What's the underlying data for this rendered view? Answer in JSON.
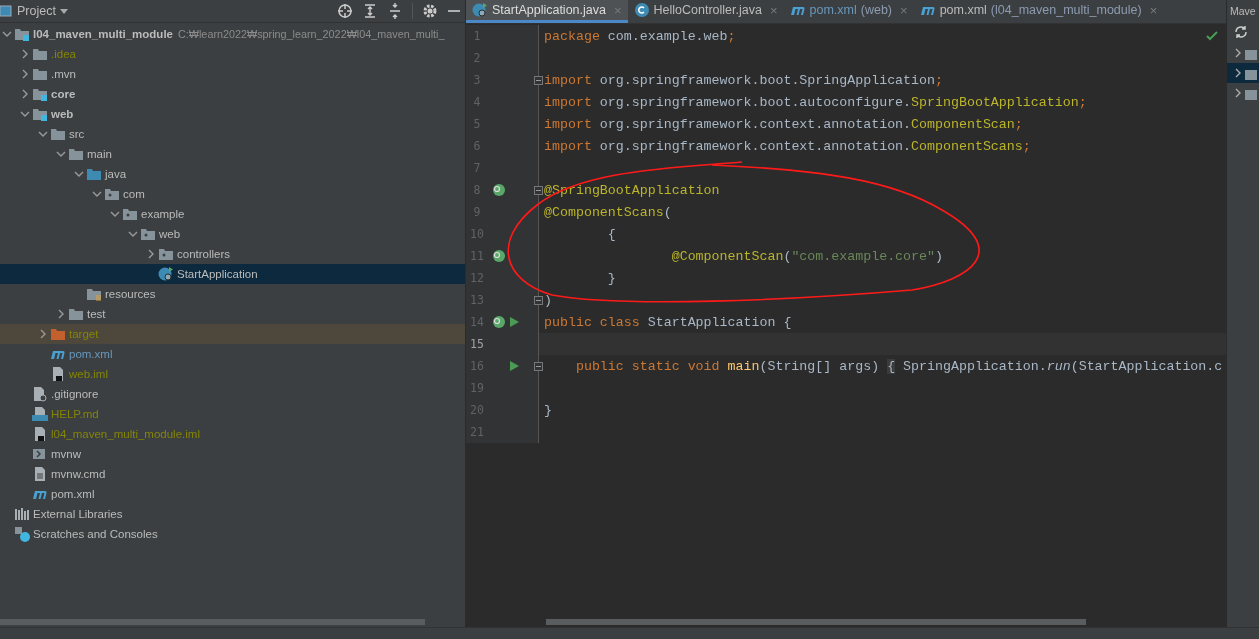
{
  "project_panel": {
    "title": "Project",
    "tree": [
      {
        "label": "l04_maven_multi_module",
        "kind": "module",
        "bold": true,
        "expanded": true,
        "path": "C:₩learn2022₩spring_learn_2022₩l04_maven_multi_",
        "ignored": false,
        "modified": false,
        "selected": false,
        "children": [
          {
            "label": ".idea",
            "kind": "folder",
            "expanded": false,
            "ignored": true,
            "modified": false,
            "selected": false
          },
          {
            "label": ".mvn",
            "kind": "folder",
            "expanded": false,
            "ignored": false,
            "modified": false,
            "selected": false
          },
          {
            "label": "core",
            "kind": "module",
            "bold": true,
            "expanded": false,
            "ignored": false,
            "modified": false,
            "selected": false
          },
          {
            "label": "web",
            "kind": "module",
            "bold": true,
            "expanded": true,
            "ignored": false,
            "modified": false,
            "selected": false,
            "children": [
              {
                "label": "src",
                "kind": "folder",
                "expanded": true,
                "ignored": false,
                "modified": false,
                "selected": false,
                "children": [
                  {
                    "label": "main",
                    "kind": "folder",
                    "expanded": true,
                    "ignored": false,
                    "modified": false,
                    "selected": false,
                    "children": [
                      {
                        "label": "java",
                        "kind": "source",
                        "expanded": true,
                        "ignored": false,
                        "modified": false,
                        "selected": false,
                        "children": [
                          {
                            "label": "com",
                            "kind": "package",
                            "expanded": true,
                            "ignored": false,
                            "modified": false,
                            "selected": false,
                            "children": [
                              {
                                "label": "example",
                                "kind": "package",
                                "expanded": true,
                                "ignored": false,
                                "modified": false,
                                "selected": false,
                                "children": [
                                  {
                                    "label": "web",
                                    "kind": "package",
                                    "expanded": true,
                                    "ignored": false,
                                    "modified": false,
                                    "selected": false,
                                    "children": [
                                      {
                                        "label": "controllers",
                                        "kind": "package",
                                        "expanded": false,
                                        "ignored": false,
                                        "modified": false,
                                        "selected": false
                                      },
                                      {
                                        "label": "StartApplication",
                                        "kind": "spring-class",
                                        "ignored": false,
                                        "modified": false,
                                        "selected": true
                                      }
                                    ]
                                  }
                                ]
                              }
                            ]
                          }
                        ]
                      },
                      {
                        "label": "resources",
                        "kind": "resources",
                        "ignored": false,
                        "modified": false,
                        "selected": false
                      }
                    ]
                  },
                  {
                    "label": "test",
                    "kind": "folder",
                    "expanded": false,
                    "ignored": false,
                    "modified": false,
                    "selected": false
                  }
                ]
              },
              {
                "label": "target",
                "kind": "excluded",
                "expanded": false,
                "ignored": true,
                "modified": false,
                "selected": false
              },
              {
                "label": "pom.xml",
                "kind": "maven",
                "ignored": false,
                "modified": true,
                "selected": false
              },
              {
                "label": "web.iml",
                "kind": "iml",
                "ignored": true,
                "modified": false,
                "selected": false
              }
            ]
          },
          {
            "label": ".gitignore",
            "kind": "gitignore",
            "ignored": false,
            "modified": false,
            "selected": false
          },
          {
            "label": "HELP.md",
            "kind": "markdown",
            "ignored": true,
            "modified": false,
            "selected": false
          },
          {
            "label": "l04_maven_multi_module.iml",
            "kind": "iml",
            "ignored": true,
            "modified": false,
            "selected": false
          },
          {
            "label": "mvnw",
            "kind": "script",
            "ignored": false,
            "modified": false,
            "selected": false
          },
          {
            "label": "mvnw.cmd",
            "kind": "text",
            "ignored": false,
            "modified": false,
            "selected": false
          },
          {
            "label": "pom.xml",
            "kind": "maven",
            "ignored": false,
            "modified": false,
            "selected": false
          }
        ]
      },
      {
        "label": "External Libraries",
        "kind": "libraries",
        "ignored": false,
        "modified": false,
        "selected": false
      },
      {
        "label": "Scratches and Consoles",
        "kind": "scratches",
        "ignored": false,
        "modified": false,
        "selected": false
      }
    ]
  },
  "editor": {
    "tabs": [
      {
        "label": "StartApplication.java",
        "kind": "spring-class",
        "modified": false,
        "selected": true,
        "close": "×"
      },
      {
        "label": "HelloController.java",
        "kind": "class",
        "modified": false,
        "selected": false,
        "close": "×"
      },
      {
        "label": "pom.xml",
        "hint": "(web)",
        "kind": "maven",
        "modified": true,
        "selected": false,
        "close": "×"
      },
      {
        "label": "pom.xml",
        "hint": "(l04_maven_multi_module)",
        "kind": "maven",
        "modified": false,
        "selected": false,
        "close": "×"
      }
    ],
    "lines": [
      {
        "number": "1",
        "current": false,
        "tokens": [
          {
            "kind": "keyword",
            "text": "package"
          },
          {
            "kind": "plain",
            "text": " com.example.web"
          },
          {
            "kind": "keyword",
            "text": ";"
          }
        ]
      },
      {
        "number": "2",
        "current": false
      },
      {
        "number": "3",
        "current": false,
        "fold": true,
        "tokens": [
          {
            "kind": "keyword",
            "text": "import"
          },
          {
            "kind": "plain",
            "text": " org.springframework.boot.SpringApplication"
          },
          {
            "kind": "keyword",
            "text": ";"
          }
        ]
      },
      {
        "number": "4",
        "current": false,
        "tokens": [
          {
            "kind": "keyword",
            "text": "import"
          },
          {
            "kind": "plain",
            "text": " org.springframework.boot.autoconfigure."
          },
          {
            "kind": "annotation",
            "text": "SpringBootApplication"
          },
          {
            "kind": "keyword",
            "text": ";"
          }
        ]
      },
      {
        "number": "5",
        "current": false,
        "tokens": [
          {
            "kind": "keyword",
            "text": "import"
          },
          {
            "kind": "plain",
            "text": " org.springframework.context.annotation."
          },
          {
            "kind": "annotation",
            "text": "ComponentScan"
          },
          {
            "kind": "keyword",
            "text": ";"
          }
        ]
      },
      {
        "number": "6",
        "current": false,
        "tokens": [
          {
            "kind": "keyword",
            "text": "import"
          },
          {
            "kind": "plain",
            "text": " org.springframework.context.annotation."
          },
          {
            "kind": "annotation",
            "text": "ComponentScans"
          },
          {
            "kind": "keyword",
            "text": ";"
          }
        ]
      },
      {
        "number": "7",
        "current": false
      },
      {
        "number": "8",
        "current": false,
        "fold": true,
        "gutter": [
          {
            "kind": "bean"
          }
        ],
        "tokens": [
          {
            "kind": "annotation",
            "text": "@SpringBootApplication"
          }
        ]
      },
      {
        "number": "9",
        "current": false,
        "tokens": [
          {
            "kind": "annotation",
            "text": "@ComponentScans"
          },
          {
            "kind": "plain",
            "text": "("
          }
        ]
      },
      {
        "number": "10",
        "current": false,
        "tokens": [
          {
            "kind": "plain",
            "text": "        {"
          }
        ]
      },
      {
        "number": "11",
        "current": false,
        "gutter": [
          {
            "kind": "bean"
          }
        ],
        "tokens": [
          {
            "kind": "annotation",
            "text": "                @ComponentScan"
          },
          {
            "kind": "plain",
            "text": "("
          },
          {
            "kind": "string",
            "text": "\"com.example.core\""
          },
          {
            "kind": "plain",
            "text": ")"
          }
        ]
      },
      {
        "number": "12",
        "current": false,
        "tokens": [
          {
            "kind": "plain",
            "text": "        }"
          }
        ]
      },
      {
        "number": "13",
        "current": false,
        "fold": true,
        "tokens": [
          {
            "kind": "plain",
            "text": ")"
          }
        ]
      },
      {
        "number": "14",
        "current": false,
        "gutter": [
          {
            "kind": "bean"
          },
          {
            "kind": "run"
          }
        ],
        "tokens": [
          {
            "kind": "keyword",
            "text": "public class "
          },
          {
            "kind": "plain",
            "text": "StartApplication {"
          }
        ]
      },
      {
        "number": "15",
        "current": true
      },
      {
        "number": "16",
        "current": false,
        "fold": true,
        "gutter": [
          {
            "kind": "run"
          }
        ],
        "tokens": [
          {
            "kind": "keyword",
            "text": "    public static void "
          },
          {
            "kind": "method",
            "text": "main"
          },
          {
            "kind": "plain",
            "text": "(String[] args) "
          },
          {
            "kind": "folded",
            "text": "{"
          },
          {
            "kind": "plain",
            "text": " SpringApplication."
          },
          {
            "kind": "static",
            "text": "run"
          },
          {
            "kind": "plain",
            "text": "(StartApplication.c"
          }
        ]
      },
      {
        "number": "19",
        "current": false
      },
      {
        "number": "20",
        "current": false,
        "tokens": [
          {
            "kind": "plain",
            "text": "}"
          }
        ]
      },
      {
        "number": "21",
        "current": false
      }
    ],
    "annotation": {
      "kind": "freehand-ellipse"
    }
  },
  "maven_panel": {
    "title": "Mave",
    "items": [
      {
        "selected": false
      },
      {
        "selected": true
      },
      {
        "selected": false
      }
    ]
  }
}
